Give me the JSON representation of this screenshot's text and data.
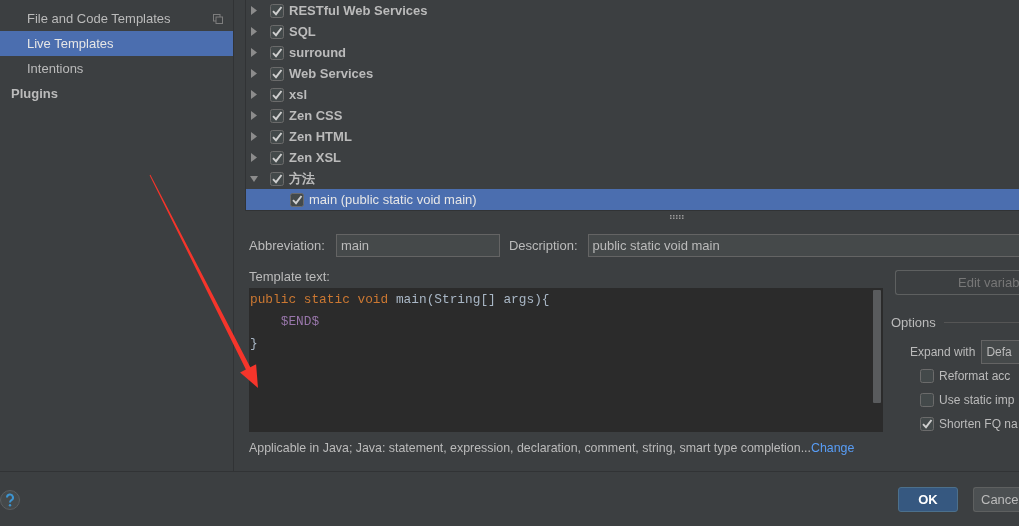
{
  "sidebar": {
    "items": [
      {
        "label": "File and Code Templates",
        "kind": "item",
        "selected": false,
        "icon": true
      },
      {
        "label": "Live Templates",
        "kind": "item",
        "selected": true,
        "icon": false
      },
      {
        "label": "Intentions",
        "kind": "item",
        "selected": false,
        "icon": false
      },
      {
        "label": "Plugins",
        "kind": "section",
        "selected": false,
        "icon": false
      }
    ]
  },
  "tree": {
    "items": [
      {
        "label": "RESTful Web Services",
        "expanded": false,
        "checked": true,
        "selected": false
      },
      {
        "label": "SQL",
        "expanded": false,
        "checked": true,
        "selected": false
      },
      {
        "label": "surround",
        "expanded": false,
        "checked": true,
        "selected": false
      },
      {
        "label": "Web Services",
        "expanded": false,
        "checked": true,
        "selected": false
      },
      {
        "label": "xsl",
        "expanded": false,
        "checked": true,
        "selected": false
      },
      {
        "label": "Zen CSS",
        "expanded": false,
        "checked": true,
        "selected": false
      },
      {
        "label": "Zen HTML",
        "expanded": false,
        "checked": true,
        "selected": false
      },
      {
        "label": "Zen XSL",
        "expanded": false,
        "checked": true,
        "selected": false
      },
      {
        "label": "方法",
        "expanded": true,
        "checked": true,
        "selected": false,
        "children": [
          {
            "label": "main (public static void main)",
            "checked": true,
            "selected": true
          }
        ]
      }
    ]
  },
  "template": {
    "abbreviation": {
      "label": "Abbreviation:",
      "value": "main"
    },
    "description": {
      "label": "Description:",
      "value": "public static void main"
    },
    "text_label": "Template text:",
    "code_lines": [
      {
        "tokens": [
          {
            "kind": "keyword",
            "text": "public static void"
          },
          {
            "kind": "plain",
            "text": " main(String[] args){"
          }
        ]
      },
      {
        "tokens": [
          {
            "kind": "variable",
            "text": "    $END$"
          }
        ]
      },
      {
        "tokens": [
          {
            "kind": "plain",
            "text": "}"
          }
        ]
      }
    ],
    "applicable": {
      "text": "Applicable in Java; Java: statement, expression, declaration, comment, string, smart type completion...",
      "link": "Change"
    }
  },
  "options_panel": {
    "edit_button": {
      "label": "Edit variab",
      "disabled": true
    },
    "title": "Options",
    "expand_with": {
      "label": "Expand with",
      "value": "Defa"
    },
    "checkboxes": [
      {
        "label": "Reformat acc",
        "checked": false
      },
      {
        "label": "Use static imp",
        "checked": false
      },
      {
        "label": "Shorten FQ na",
        "checked": true
      }
    ]
  },
  "footer": {
    "buttons": [
      {
        "label": "OK",
        "kind": "default"
      },
      {
        "label": "Cance",
        "kind": "normal"
      }
    ]
  }
}
